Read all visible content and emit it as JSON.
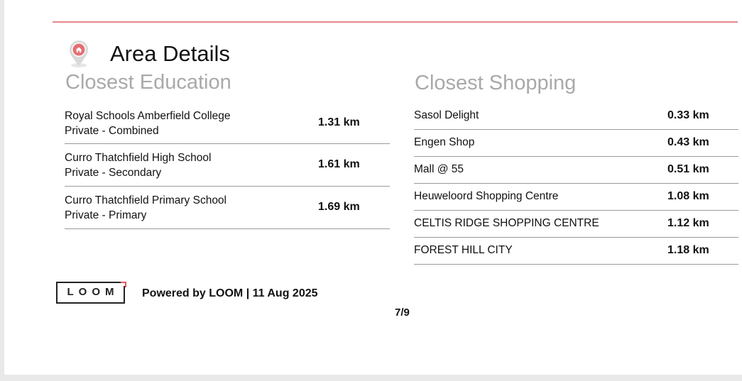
{
  "page": {
    "title": "Area Details",
    "accent_color": "#e3898b",
    "pin_icon": "location-pin-home-icon"
  },
  "education": {
    "heading": "Closest Education",
    "items": [
      {
        "name": "Royal Schools Amberfield College",
        "type": "Private - Combined",
        "distance": "1.31 km"
      },
      {
        "name": "Curro Thatchfield High School",
        "type": "Private - Secondary",
        "distance": "1.61 km"
      },
      {
        "name": "Curro Thatchfield Primary School",
        "type": "Private - Primary",
        "distance": "1.69 km"
      }
    ]
  },
  "shopping": {
    "heading": "Closest Shopping",
    "items": [
      {
        "name": "Sasol Delight",
        "distance": "0.33 km"
      },
      {
        "name": "Engen Shop",
        "distance": "0.43 km"
      },
      {
        "name": "Mall @ 55",
        "distance": "0.51 km"
      },
      {
        "name": "Heuweloord Shopping Centre",
        "distance": "1.08 km"
      },
      {
        "name": "CELTIS RIDGE SHOPPING CENTRE",
        "distance": "1.12 km"
      },
      {
        "name": "FOREST HILL CITY",
        "distance": "1.18 km"
      }
    ]
  },
  "footer": {
    "logo_text": "LOOM",
    "powered_by": "Powered by LOOM | 11 Aug 2025",
    "page_number": "7/9"
  }
}
